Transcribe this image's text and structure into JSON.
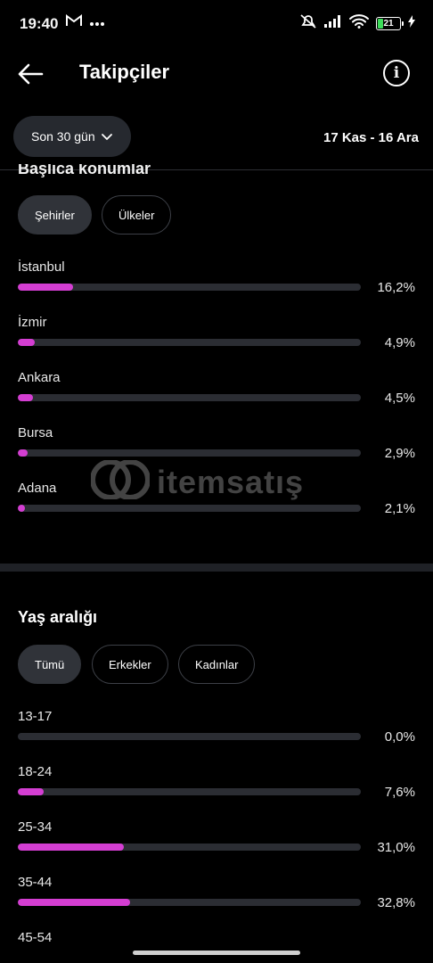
{
  "status_bar": {
    "time": "19:40",
    "battery_level": "21",
    "battery_color": "#3ddc5a"
  },
  "app_bar": {
    "title": "Takipçiler",
    "back_icon": "arrow-left-icon",
    "info_icon": "info-icon"
  },
  "filter": {
    "period_label": "Son 30 gün",
    "date_range": "17 Kas - 16 Ara"
  },
  "locations": {
    "title": "Başlıca konumlar",
    "tabs": [
      {
        "label": "Şehirler",
        "active": true
      },
      {
        "label": "Ülkeler",
        "active": false
      }
    ],
    "rows": [
      {
        "name": "İstanbul",
        "percent_text": "16,2%",
        "value": 16.2
      },
      {
        "name": "İzmir",
        "percent_text": "4,9%",
        "value": 4.9
      },
      {
        "name": "Ankara",
        "percent_text": "4,5%",
        "value": 4.5
      },
      {
        "name": "Bursa",
        "percent_text": "2,9%",
        "value": 2.9
      },
      {
        "name": "Adana",
        "percent_text": "2,1%",
        "value": 2.1
      }
    ]
  },
  "age": {
    "title": "Yaş aralığı",
    "tabs": [
      {
        "label": "Tümü",
        "active": true
      },
      {
        "label": "Erkekler",
        "active": false
      },
      {
        "label": "Kadınlar",
        "active": false
      }
    ],
    "rows": [
      {
        "name": "13-17",
        "percent_text": "0,0%",
        "value": 0.0
      },
      {
        "name": "18-24",
        "percent_text": "7,6%",
        "value": 7.6
      },
      {
        "name": "25-34",
        "percent_text": "31,0%",
        "value": 31.0
      },
      {
        "name": "35-44",
        "percent_text": "32,8%",
        "value": 32.8
      },
      {
        "name": "45-54",
        "percent_text": "",
        "value": null
      }
    ]
  },
  "watermark": {
    "text": "itemsatış"
  },
  "colors": {
    "background": "#000000",
    "accent_bar": "#d43ed2",
    "track": "#2b2d33",
    "chip_active": "#303339"
  }
}
